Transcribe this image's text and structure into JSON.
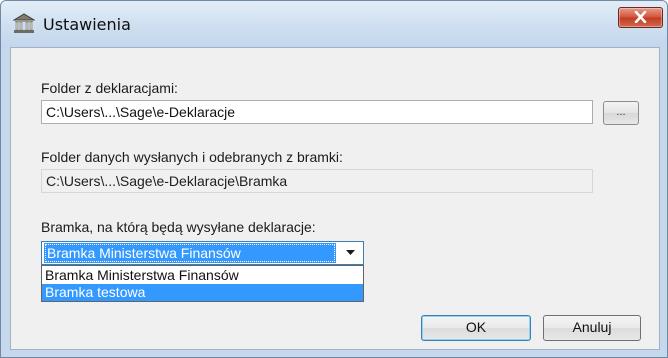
{
  "window": {
    "title": "Ustawienia",
    "close_label": "Zamknij"
  },
  "declarations_folder": {
    "label": "Folder z deklaracjami:",
    "value": "C:\\Users\\...\\Sage\\e-Deklaracje",
    "browse_label": "..."
  },
  "gateway_data_folder": {
    "label": "Folder danych wysłanych i odebranych z bramki:",
    "value": "C:\\Users\\...\\Sage\\e-Deklaracje\\Bramka"
  },
  "gateway": {
    "label": "Bramka, na którą będą wysyłane deklaracje:",
    "selected": "Bramka Ministerstwa Finansów",
    "options": [
      "Bramka Ministerstwa Finansów",
      "Bramka testowa"
    ],
    "highlighted_option": "Bramka testowa"
  },
  "buttons": {
    "ok": "OK",
    "cancel": "Anuluj"
  },
  "icons": {
    "app": "building-icon",
    "close": "close-icon",
    "dropdown": "chevron-down-icon"
  },
  "colors": {
    "selection": "#3399ff",
    "close_button": "#c94a32",
    "dialog_background": "#f0f0f0"
  }
}
